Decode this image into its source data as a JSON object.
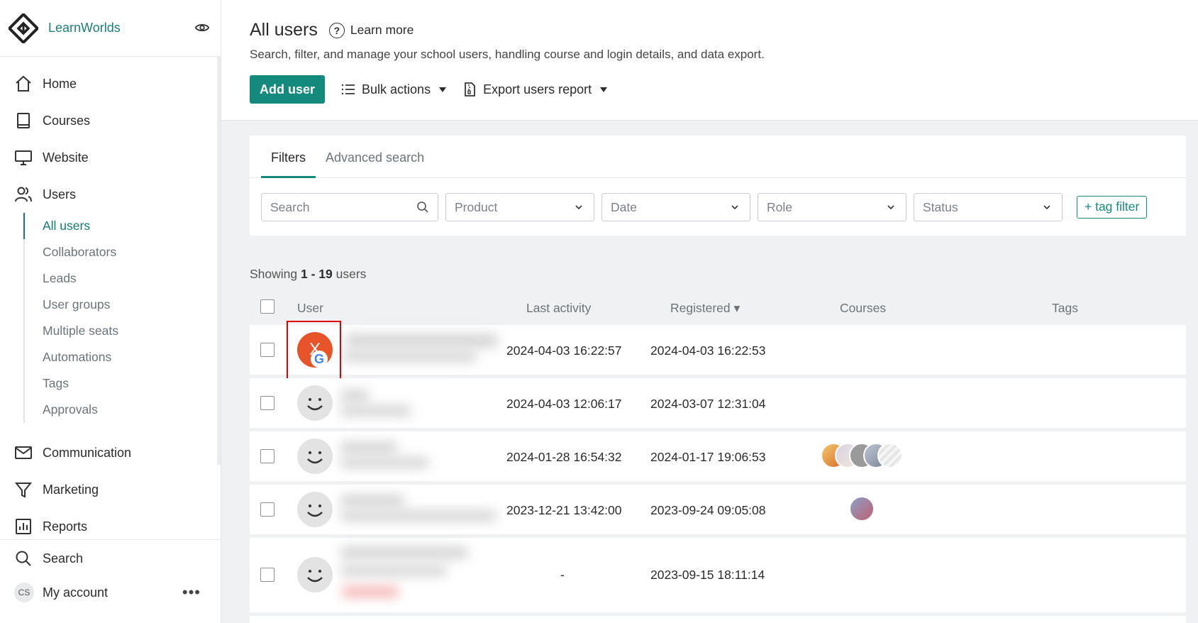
{
  "sidebar": {
    "brand": "LearnWorlds",
    "nav": [
      {
        "label": "Home",
        "icon": "home-icon"
      },
      {
        "label": "Courses",
        "icon": "book-icon"
      },
      {
        "label": "Website",
        "icon": "monitor-icon"
      },
      {
        "label": "Users",
        "icon": "users-icon"
      }
    ],
    "sub": [
      "All users",
      "Collaborators",
      "Leads",
      "User groups",
      "Multiple seats",
      "Automations",
      "Tags",
      "Approvals"
    ],
    "nav2": [
      {
        "label": "Communication",
        "icon": "mail-icon"
      },
      {
        "label": "Marketing",
        "icon": "funnel-icon"
      },
      {
        "label": "Reports",
        "icon": "chart-icon"
      }
    ],
    "search": "Search",
    "account": "My account",
    "account_initials": "CS"
  },
  "header": {
    "title": "All users",
    "learn_more": "Learn more",
    "subtitle": "Search, filter, and manage your school users, handling course and login details, and data export.",
    "add_user": "Add user",
    "bulk_actions": "Bulk actions",
    "export": "Export users report"
  },
  "filters": {
    "tabs": [
      "Filters",
      "Advanced search"
    ],
    "search_placeholder": "Search",
    "product": "Product",
    "date": "Date",
    "role": "Role",
    "status": "Status",
    "tag_filter": "+ tag filter"
  },
  "table": {
    "showing_prefix": "Showing ",
    "showing_range": "1 - 19",
    "showing_suffix": " users",
    "columns": {
      "user": "User",
      "last_activity": "Last activity",
      "registered": "Registered ▾",
      "courses": "Courses",
      "tags": "Tags"
    },
    "rows": [
      {
        "avatar_initial": "X",
        "last_activity": "2024-04-03 16:22:57",
        "registered": "2024-04-03 16:22:53"
      },
      {
        "avatar_initial": "",
        "last_activity": "2024-04-03 12:06:17",
        "registered": "2024-03-07 12:31:04"
      },
      {
        "avatar_initial": "",
        "last_activity": "2024-01-28 16:54:32",
        "registered": "2024-01-17 19:06:53"
      },
      {
        "avatar_initial": "",
        "last_activity": "2023-12-21 13:42:00",
        "registered": "2023-09-24 09:05:08"
      },
      {
        "avatar_initial": "",
        "last_activity": "-",
        "registered": "2023-09-15 18:11:14"
      }
    ]
  },
  "colors": {
    "accent": "#138a7c",
    "highlight": "#e00000",
    "avatar_orange": "#e8542a"
  }
}
